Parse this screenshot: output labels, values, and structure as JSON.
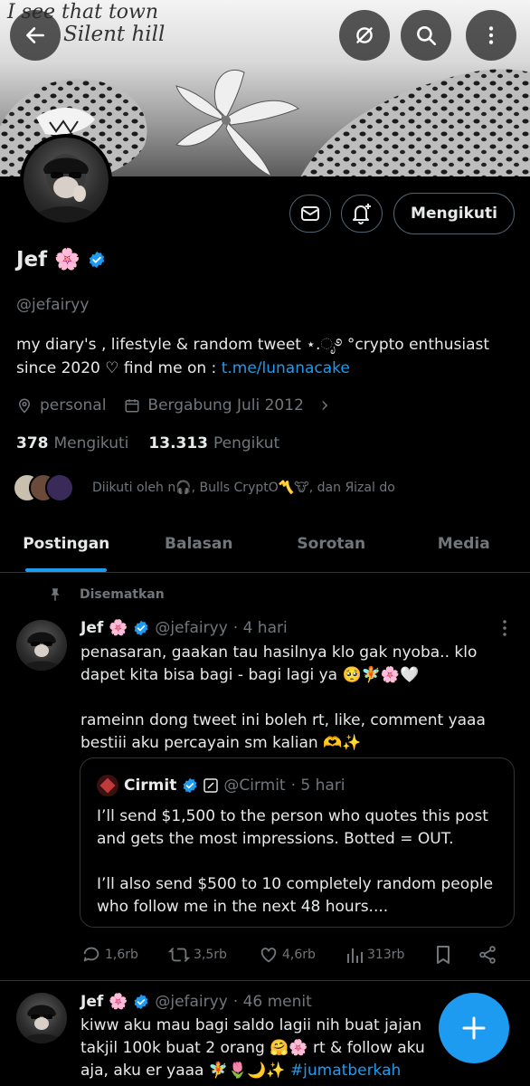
{
  "banner": {
    "line1": "I see that town",
    "line2": "Silent hill"
  },
  "profile": {
    "name": "Jef 🌸",
    "handle": "@jefairyy",
    "bio_text": "my diary's , lifestyle & random tweet ⋆.ೃ࿔ °crypto enthusiast since 2020 ♡ find me on : ",
    "bio_link": "t.me/lunanacake",
    "category": "personal",
    "joined": "Bergabung Juli 2012",
    "following_count": "378",
    "following_label": "Mengikuti",
    "followers_count": "13.313",
    "followers_label": "Pengikut",
    "followed_by": "Diikuti oleh n🎧, Bulls CryptO〽️🐮, dan Яizal do"
  },
  "buttons": {
    "follow": "Mengikuti"
  },
  "tabs": [
    {
      "label": "Postingan"
    },
    {
      "label": "Balasan"
    },
    {
      "label": "Sorotan"
    },
    {
      "label": "Media"
    }
  ],
  "pinned_label": "Disematkan",
  "posts": [
    {
      "name": "Jef 🌸",
      "handle": "@jefairyy",
      "time": "· 4 hari",
      "line1": "penasaran, gaakan tau hasilnya klo gak nyoba.. klo dapet kita bisa bagi - bagi lagi ya 🥺🧚🌸🤍",
      "line2": "rameinn dong tweet ini boleh rt, like, comment yaaa bestiii aku percayain sm kalian 🫶✨",
      "quote": {
        "name": "Cirmit",
        "handle": "@Cirmit",
        "time": "· 5 hari",
        "p1": "I’ll send $1,500 to the person who quotes this post and gets the most impressions. Botted = OUT.",
        "p2": "I’ll also send $500 to 10 completely random people who follow me in the next 48 hours...."
      },
      "stats": {
        "replies": "1,6rb",
        "retweets": "3,5rb",
        "likes": "4,6rb",
        "views": "313rb"
      }
    },
    {
      "name": "Jef 🌸",
      "handle": "@jefairyy",
      "time": "· 46 menit",
      "text": "kiww aku mau bagi saldo lagii nih buat jajan takjil 100k buat 2 orang 🤗🌸 rt & follow aku aja, aku er yaaa 🧚🌷🌙✨ ",
      "tag": "#jumatberkah"
    }
  ],
  "colors": {
    "accent": "#1d9bf0",
    "muted": "#71767b",
    "border": "#2f3336"
  }
}
